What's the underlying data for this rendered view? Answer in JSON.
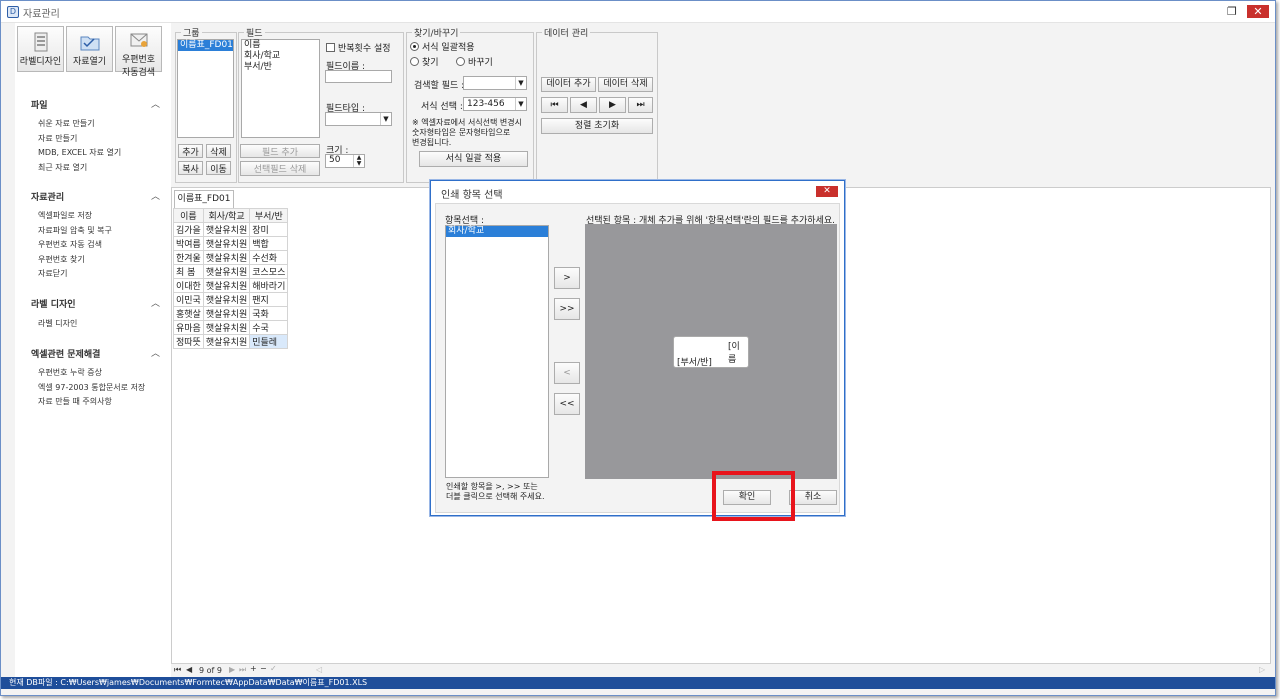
{
  "window": {
    "title": "자료관리",
    "icon": "app-icon",
    "icon_text": "D"
  },
  "sidebar": {
    "top_buttons": [
      {
        "label": "라벨디자인",
        "icon": "label-design-icon"
      },
      {
        "label": "자료열기",
        "icon": "folder-open-icon"
      },
      {
        "label1": "우편번호",
        "label2": "자동검색",
        "icon": "postcode-icon"
      }
    ],
    "sections": [
      {
        "title": "파일",
        "items": [
          "쉬운 자료 만들기",
          "자료 만들기",
          "MDB, EXCEL 자료 열기",
          "최근 자료 열기"
        ]
      },
      {
        "title": "자료관리",
        "items": [
          "엑셀파일로 저장",
          "자료파일 압축 및 복구",
          "우편번호 자동 검색",
          "우편번호 찾기",
          "자료닫기"
        ]
      },
      {
        "title": "라벨 디자인",
        "items": [
          "라벨 디자인"
        ]
      },
      {
        "title": "엑셀관련 문제해결",
        "items": [
          "우편번호 누락 증상",
          "엑셀 97-2003 통합문서로 저장",
          "자료 만들 때 주의사항"
        ]
      }
    ]
  },
  "group": {
    "label": "그룹",
    "items": [
      "이름표_FD01"
    ],
    "btn_add": "추가",
    "btn_delete": "삭제",
    "btn_copy": "복사",
    "btn_move": "이동"
  },
  "field": {
    "label": "필드",
    "items": [
      "이름",
      "회사/학교",
      "부서/반"
    ],
    "repeat_label": "반복횟수 설정",
    "name_label": "필드이름 :",
    "type_label": "필드타입 :",
    "size_label": "크기 :",
    "size_value": "50",
    "btn_add": "필드 추가",
    "btn_delete": "선택필드 삭제"
  },
  "find": {
    "label": "찾기/바꾸기",
    "opt_batch": "서식 일괄적용",
    "opt_find": "찾기",
    "opt_replace": "바꾸기",
    "search_field_label": "검색할 필드 :",
    "format_label": "서식 선택 :",
    "format_value": "123-456",
    "note": "※ 엑셀자료에서 서식선택 변경시\n숫자형타입은 문자형타입으로\n변경됩니다.",
    "btn_apply": "서식 일괄 적용"
  },
  "data_mgmt": {
    "label": "데이터 관리",
    "btn_add": "데이터 추가",
    "btn_delete": "데이터 삭제",
    "btn_reset": "정렬 초기화"
  },
  "sheet": {
    "tab": "이름표_FD01",
    "columns": [
      "이름",
      "회사/학교",
      "부서/반"
    ],
    "rows": [
      [
        "김가을",
        "햇살유치원",
        "장미"
      ],
      [
        "박여름",
        "햇살유치원",
        "백합"
      ],
      [
        "한겨울",
        "햇살유치원",
        "수선화"
      ],
      [
        "최 봄",
        "햇살유치원",
        "코스모스"
      ],
      [
        "이대한",
        "햇살유치원",
        "해바라기"
      ],
      [
        "이민국",
        "햇살유치원",
        "팬지"
      ],
      [
        "홍햇살",
        "햇살유치원",
        "국화"
      ],
      [
        "유마음",
        "햇살유치원",
        "수국"
      ],
      [
        "정따뜻",
        "햇살유치원",
        "민들레"
      ]
    ]
  },
  "pager": {
    "text": "9 of 9"
  },
  "status": {
    "text": "현재 DB파일 : C:₩Users₩james₩Documents₩Formtec₩AppData₩Data₩이름표_FD01.XLS"
  },
  "dialog": {
    "title": "인쇄 항목 선택",
    "left_label": "항목선택 :",
    "left_items": [
      "회사/학교"
    ],
    "right_label": "선택된 항목 :  개체 추가를 위해 '항목선택'란의 필드를 추가하세요.",
    "btn_add": ">",
    "btn_add_all": ">>",
    "btn_remove": "<",
    "btn_remove_all": "<<",
    "preview_line1": "[이름",
    "preview_line2": "[부서/반]",
    "hint": "인쇄할 항목을  >, >> 또는\n더블 클릭으로 선택해 주세요.",
    "btn_ok": "확인",
    "btn_cancel": "취소"
  },
  "colors": {
    "accent": "#2b7fd8",
    "status_bar": "#1f4e9a",
    "close": "#c9302c",
    "highlight": "#e8141c",
    "preview_bg": "#98989b"
  }
}
